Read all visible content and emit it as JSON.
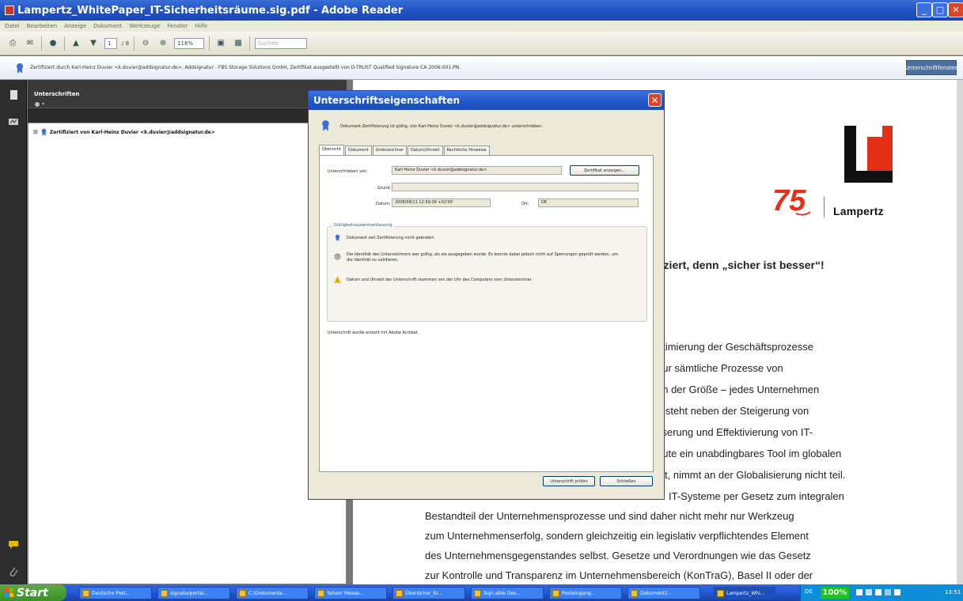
{
  "window": {
    "title": "Lampertz_WhitePaper_IT-Sicherheitsräume.sig.pdf - Adobe Reader"
  },
  "menubar": [
    "Datei",
    "Bearbeiten",
    "Anzeige",
    "Dokument",
    "Werkzeuge",
    "Fenster",
    "Hilfe"
  ],
  "toolbar": {
    "page_current": "1",
    "page_total": "/ 8",
    "zoom": "116%",
    "search_placeholder": "Suchen"
  },
  "signature_bar": {
    "text": "Zertifiziert durch Karl-Heinz Duvier <k.duvier@addsignatur.de>, Addsignatur - FBS Storage Solutions GmbH, Zertifikat ausgestellt von D-TRUST Qualified Signature CA 2006:001:PN.",
    "panel_button": "Unterschriftfenster"
  },
  "sig_panel": {
    "title": "Unterschriften",
    "tree_item": "Zertifiziert von Karl-Heinz Duvier <k.duvier@addsignatur.de>"
  },
  "document": {
    "company": "Lampertz",
    "anniversary": "75",
    "lines": [
      "fiziert, denn „sicher ist besser“!",
      "ptimierung der Geschäftsprozesse",
      "nur sämtliche Prozesse von",
      "on der Größe – jedes Unternehmen",
      "g steht neben der Steigerung von",
      "sserung und Effektivierung von IT-",
      "eute ein unabdingbares Tool im globalen",
      "t, nimmt an der Globalisierung nicht teil.",
      "IT-Systeme per Gesetz zum integralen",
      "Bestandteil der Unternehmensprozesse und sind daher nicht mehr nur Werkzeug",
      "zum Unternehmenserfolg, sondern gleichzeitig ein legislativ verpflichtendes Element",
      "des Unternehmensgegenstandes selbst. Gesetze und Verordnungen wie das Gesetz",
      "zur Kontrolle und Transparenz im Unternehmensbereich (KonTraG), Basel II oder der"
    ]
  },
  "dialog": {
    "title": "Unterschriftseigenschaften",
    "summary": "Dokument-Zertifizierung ist gültig, von Karl-Heinz Duvier <k.duvier@addsignatur.de> unterschrieben.",
    "tabs": [
      "Übersicht",
      "Dokument",
      "Unterzeichner",
      "Datum/Uhrzeit",
      "Rechtliche Hinweise"
    ],
    "labels": {
      "signed_by": "Unterschrieben von:",
      "reason": "Grund:",
      "date": "Datum:",
      "location": "Ort:"
    },
    "values": {
      "signed_by": "Karl-Heinz Duvier <k.duvier@addsignatur.de>",
      "reason": "",
      "date": "2008/08/11 12:59:39 +02'00'",
      "location": "DE"
    },
    "show_cert_button": "Zertifikat anzeigen...",
    "validity_group": "Gültigkeitszusammenfassung",
    "validity": [
      "Dokument seit Zertifizierung nicht geändert.",
      "Die Identität des Unterzeichners war gültig, als sie ausgegeben wurde. Es konnte dabei jedoch nicht auf Sperrungen geprüft werden, um die Identität zu validieren.",
      "Datum und Uhrzeit der Unterschrift stammen von der Uhr des Computers vom Unterzeichner."
    ],
    "created_with": "Unterschrift wurde erstellt mit Adobe Acrobat.",
    "validate_button": "Unterschrift prüfen",
    "close_button": "Schließen"
  },
  "taskbar": {
    "start": "Start",
    "tasks": [
      "Deutsche Post...",
      "signaturportal...",
      "C:\\Dokumente...",
      "Yahoo! Messe...",
      "Übersicher_IU...",
      "Sign.able Dev...",
      "Posteingang...",
      "Dokument1 -",
      "Lampertz_Whi..."
    ],
    "lang": "DE",
    "zoom": "100%",
    "clock": "13:51"
  }
}
